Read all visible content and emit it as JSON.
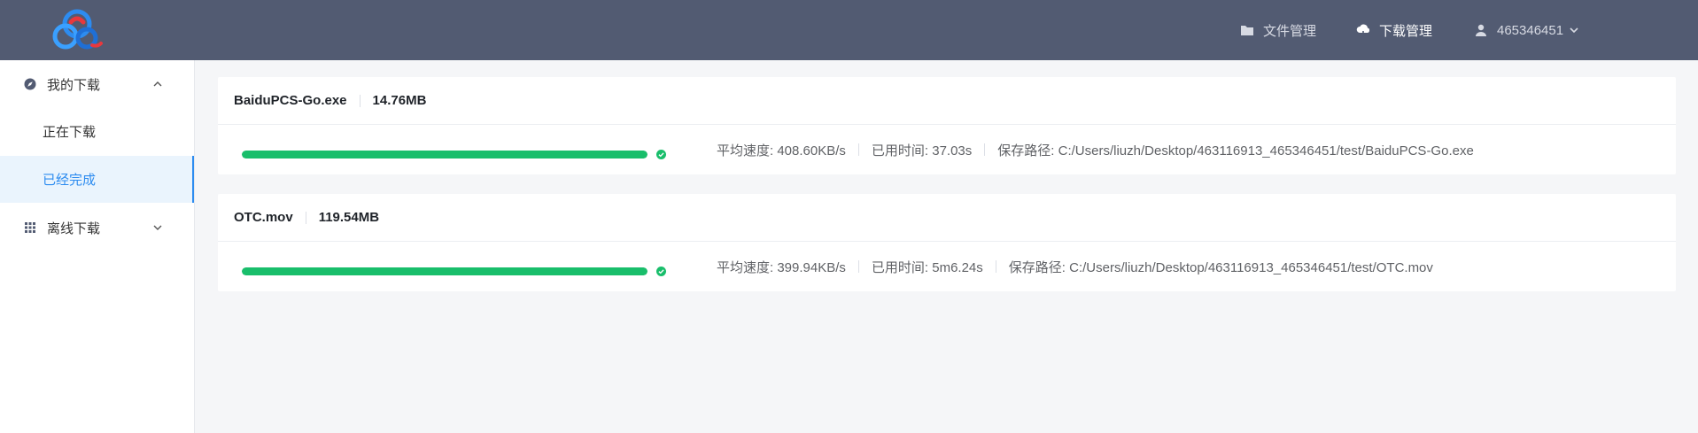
{
  "header": {
    "nav": [
      {
        "label": "文件管理",
        "icon": "folder-icon",
        "active": false
      },
      {
        "label": "下载管理",
        "icon": "cloud-download-icon",
        "active": true
      }
    ],
    "user": {
      "name": "465346451",
      "icon": "user-icon"
    }
  },
  "sidebar": {
    "groups": [
      {
        "label": "我的下载",
        "icon": "compass-icon",
        "expanded": true,
        "items": [
          {
            "label": "正在下载",
            "active": false
          },
          {
            "label": "已经完成",
            "active": true
          }
        ]
      },
      {
        "label": "离线下载",
        "icon": "grid-icon",
        "expanded": false
      }
    ]
  },
  "downloads": [
    {
      "name": "BaiduPCS-Go.exe",
      "size": "14.76MB",
      "progress": 1.0,
      "speed": "平均速度: 408.60KB/s",
      "elapsed": "已用时间: 37.03s",
      "path": "保存路径: C:/Users/liuzh/Desktop/463116913_465346451/test/BaiduPCS-Go.exe"
    },
    {
      "name": "OTC.mov",
      "size": "119.54MB",
      "progress": 1.0,
      "speed": "平均速度: 399.94KB/s",
      "elapsed": "已用时间: 5m6.24s",
      "path": "保存路径: C:/Users/liuzh/Desktop/463116913_465346451/test/OTC.mov"
    }
  ],
  "colors": {
    "header_bg": "#525b72",
    "accent": "#2d8cf0",
    "success": "#19be6b"
  }
}
